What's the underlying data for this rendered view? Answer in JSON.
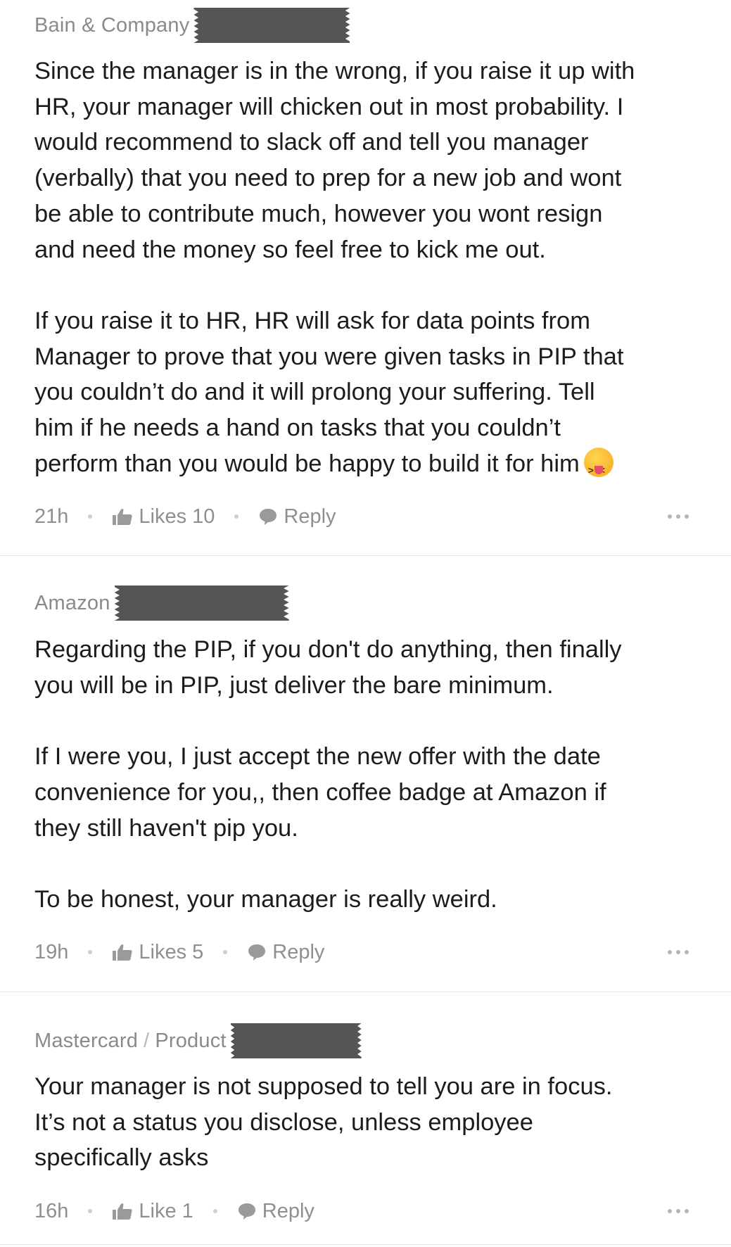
{
  "comments": [
    {
      "company": "Bain & Company",
      "role": "",
      "body": [
        "Since the manager is in the wrong, if you raise it up with",
        "HR, your manager will chicken out in most probability. I",
        "would recommend to slack off and tell you manager",
        "(verbally) that you need to prep for a new job and wont",
        "be able to contribute much, however you wont resign",
        "and need the money so feel free to kick me out.",
        "",
        "If you raise it to HR, HR will ask for data points from",
        "Manager to prove that you were given tasks in PIP that",
        "you couldn’t do and it will prolong your suffering. Tell",
        "him if he needs a hand on tasks that you couldn’t",
        "perform than you would be happy to build it for him"
      ],
      "time": "21h",
      "likes": "Likes 10",
      "reply": "Reply"
    },
    {
      "company": "Amazon",
      "role": "",
      "body": [
        "Regarding the PIP, if you don't do anything, then finally",
        "you will be in PIP, just deliver the bare minimum.",
        "",
        "If I were you, I just accept the new offer with the date",
        "convenience for you,, then coffee badge at Amazon if",
        "they still haven't pip you.",
        "",
        "To be honest, your manager is really weird."
      ],
      "time": "19h",
      "likes": "Likes 5",
      "reply": "Reply"
    },
    {
      "company": "Mastercard",
      "role": "Product",
      "body": [
        "Your manager is not supposed to tell you are in focus.",
        "It’s not a status you disclose, unless employee",
        "specifically asks"
      ],
      "time": "16h",
      "likes": "Like 1",
      "reply": "Reply"
    }
  ],
  "icons": {
    "like": "thumbs-up-icon",
    "reply": "speech-bubble-icon",
    "more": "more-horizontal-icon",
    "emoji": "squinting-tongue-emoji"
  }
}
